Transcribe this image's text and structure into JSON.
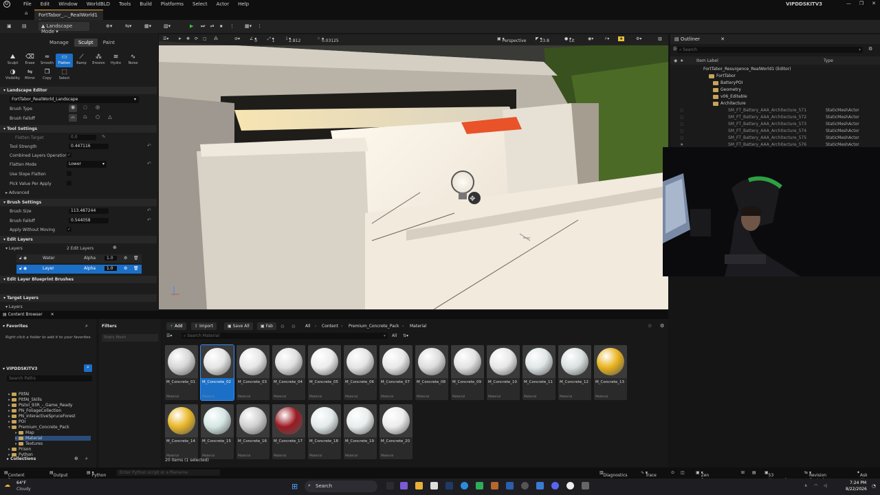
{
  "menubar": {
    "items": [
      "File",
      "Edit",
      "Window",
      "WorldBLD",
      "Tools",
      "Build",
      "Platforms",
      "Select",
      "Actor",
      "Help"
    ],
    "project": "VIPDDSKITV3"
  },
  "tab": {
    "label": "FortTabor_..._RealWorld1 •"
  },
  "toolbar": {
    "mode": "Landscape Mode"
  },
  "landscape": {
    "subtabs": [
      "Manage",
      "Sculpt",
      "Paint"
    ],
    "tools": [
      "Sculpt",
      "Erase",
      "Smooth",
      "Flatten",
      "Ramp",
      "Erosion",
      "Hydro",
      "Noise",
      "Visibility",
      "Mirror",
      "Copy",
      "Select"
    ],
    "editor_section": "Landscape Editor",
    "landscape_name": "FortTabor_RealWorld_Landscape",
    "brush_type_label": "Brush Type",
    "brush_falloff_label": "Brush Falloff",
    "tool_settings_section": "Tool Settings",
    "flatten_target_label": "Flatten Target",
    "flatten_target_value": "0.0",
    "tool_strength_label": "Tool Strength",
    "tool_strength_value": "0.447116",
    "combined_layers_label": "Combined Layers Operation",
    "flatten_mode_label": "Flatten Mode",
    "flatten_mode_value": "Lower",
    "use_slope_label": "Use Slope Flatten",
    "pick_value_label": "Pick Value Per Apply",
    "advanced_label": "Advanced",
    "brush_settings_section": "Brush Settings",
    "brush_size_label": "Brush Size",
    "brush_size_value": "113.487244",
    "brush_falloff_value": "0.544058",
    "apply_without_moving_label": "Apply Without Moving",
    "edit_layers_section": "Edit Layers",
    "layers_label": "Layers",
    "layers_count": "2 Edit Layers",
    "layer_rows": [
      {
        "name": "Water",
        "alpha_label": "Alpha",
        "alpha": "1.0"
      },
      {
        "name": "Layer",
        "alpha_label": "Alpha",
        "alpha": "1.0"
      }
    ],
    "blueprint_brushes_section": "Edit Layer Blueprint Brushes",
    "target_layers_section": "Target Layers",
    "target_layers_label": "Layers"
  },
  "viewport": {
    "perspective": "Perspective",
    "lit": "Lit",
    "fov": "23.8",
    "snap_angle": "0",
    "snap_scale": "1",
    "value_a": "2.812",
    "value_b": "0.03125"
  },
  "outliner": {
    "title": "Outliner",
    "search_placeholder": "Search",
    "col_label": "Item Label",
    "col_type": "Type",
    "rows": [
      {
        "indent": 48,
        "label": "FortTabor_Resurgence_RealWorld1 (Editor)",
        "type": "",
        "folder": false
      },
      {
        "indent": 56,
        "label": "FortTabor",
        "type": "",
        "folder": true
      },
      {
        "indent": 62,
        "label": "BatteryPOI",
        "type": "",
        "folder": true
      },
      {
        "indent": 62,
        "label": "Geometry",
        "type": "",
        "folder": true
      },
      {
        "indent": 62,
        "label": "v06_Editable",
        "type": "",
        "folder": true
      },
      {
        "indent": 62,
        "label": "Architecture",
        "type": "",
        "folder": true
      },
      {
        "indent": 84,
        "label": "SM_FT_Battery_AAA_Architecture_571",
        "type": "StaticMeshActor",
        "folder": false
      },
      {
        "indent": 84,
        "label": "SM_FT_Battery_AAA_Architecture_572",
        "type": "StaticMeshActor",
        "folder": false
      },
      {
        "indent": 84,
        "label": "SM_FT_Battery_AAA_Architecture_573",
        "type": "StaticMeshActor",
        "folder": false
      },
      {
        "indent": 84,
        "label": "SM_FT_Battery_AAA_Architecture_574",
        "type": "StaticMeshActor",
        "folder": false
      },
      {
        "indent": 84,
        "label": "SM_FT_Battery_AAA_Architecture_575",
        "type": "StaticMeshActor",
        "folder": false
      },
      {
        "indent": 84,
        "label": "SM_FT_Battery_AAA_Architecture_576",
        "type": "StaticMeshActor",
        "folder": false
      },
      {
        "indent": 84,
        "label": "SM_FT_Battery_AAA_Architecture_577",
        "type": "StaticMeshActor",
        "folder": false
      }
    ]
  },
  "content_browser": {
    "tab": "Content Browser",
    "favorites": "Favorites",
    "favorites_hint": "Right click a folder to add it to your favorites.",
    "project": "VIPDDSKITV3",
    "search_paths_placeholder": "Search Paths",
    "tree": [
      {
        "label": "PitfAI",
        "depth": 0
      },
      {
        "label": "PitfAI_Skills",
        "depth": 0
      },
      {
        "label": "Pistol_93R_-_Game_Ready",
        "depth": 0
      },
      {
        "label": "PN_FoliageCollection",
        "depth": 0
      },
      {
        "label": "PN_interactiveSpruceForest",
        "depth": 0
      },
      {
        "label": "POI",
        "depth": 0
      },
      {
        "label": "Premium_Concrete_Pack",
        "depth": 0
      },
      {
        "label": "Map",
        "depth": 1
      },
      {
        "label": "Material",
        "depth": 1
      },
      {
        "label": "Textures",
        "depth": 1
      },
      {
        "label": "Prison",
        "depth": 0
      },
      {
        "label": "Python",
        "depth": 0
      }
    ],
    "collections": "Collections",
    "filters": "Filters",
    "filter_chip": "Static Mesh",
    "add": "Add",
    "import": "Import",
    "save_all": "Save All",
    "fab": "Fab",
    "breadcrumb": [
      "All",
      "Content",
      "Premium_Concrete_Pack",
      "Material"
    ],
    "search_placeholder": "Search Material",
    "filter_all": "All",
    "assets": [
      {
        "name": "M_Concrete_01",
        "type": "Material",
        "color": "#d6d6d6"
      },
      {
        "name": "M_Concrete_02",
        "type": "Material",
        "color": "#e4e4e4"
      },
      {
        "name": "M_Concrete_03",
        "type": "Material",
        "color": "#e6e6e6"
      },
      {
        "name": "M_Concrete_04",
        "type": "Material",
        "color": "#e0e0e0"
      },
      {
        "name": "M_Concrete_05",
        "type": "Material",
        "color": "#ececec"
      },
      {
        "name": "M_Concrete_06",
        "type": "Material",
        "color": "#e5e5e5"
      },
      {
        "name": "M_Concrete_07",
        "type": "Material",
        "color": "#e8e8e8"
      },
      {
        "name": "M_Concrete_08",
        "type": "Material",
        "color": "#dcdcdc"
      },
      {
        "name": "M_Concrete_09",
        "type": "Material",
        "color": "#e2e2e2"
      },
      {
        "name": "M_Concrete_10",
        "type": "Material",
        "color": "#e7e7e7"
      },
      {
        "name": "M_Concrete_11",
        "type": "Material",
        "color": "#dfe6e6"
      },
      {
        "name": "M_Concrete_12",
        "type": "Material",
        "color": "#d9e0e0"
      },
      {
        "name": "M_Concrete_13",
        "type": "Material",
        "color": "#e8b21c"
      },
      {
        "name": "M_Concrete_14",
        "type": "Material",
        "color": "#e8b626"
      },
      {
        "name": "M_Concrete_15",
        "type": "Material",
        "color": "#d4e6e4"
      },
      {
        "name": "M_Concrete_16",
        "type": "Material",
        "color": "#cfcfcf"
      },
      {
        "name": "M_Concrete_17",
        "type": "Material",
        "color": "#9a1a22"
      },
      {
        "name": "M_Concrete_18",
        "type": "Material",
        "color": "#e3eaea"
      },
      {
        "name": "M_Concrete_19",
        "type": "Material",
        "color": "#e9eded"
      },
      {
        "name": "M_Concrete_20",
        "type": "Material",
        "color": "#ececec"
      }
    ],
    "item_count": "20 items (1 selected)"
  },
  "statusbar": {
    "content_drawer": "Content Drawer",
    "output_log": "Output Log",
    "python": "Python",
    "cmd_placeholder": "Enter Python script or a filename",
    "diagnostics": "Diagnostics",
    "trace": "Trace",
    "zen": "Zen Server",
    "unsaved": "53 Unsaved",
    "revision": "Revision Control",
    "ask": "Ask AI"
  },
  "taskbar": {
    "temp": "64°F",
    "weather": "Cloudy",
    "search": "Search",
    "time": "7:24 PM",
    "date": "8/22/2026"
  }
}
